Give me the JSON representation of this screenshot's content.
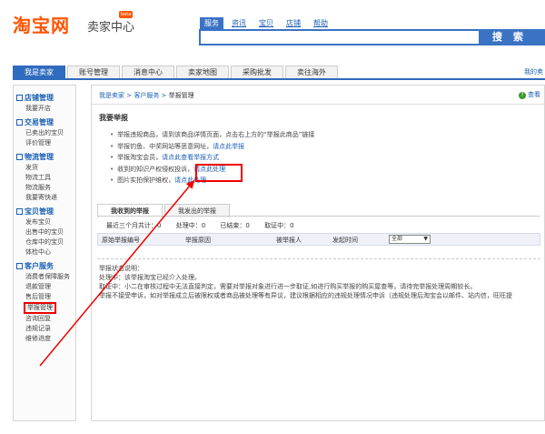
{
  "header": {
    "logo": "淘宝网",
    "logo_sub": "卖家中心",
    "beta": "beta",
    "search_tabs": [
      "服务",
      "资讯",
      "宝贝",
      "店铺",
      "帮助"
    ],
    "search_button": "搜 索"
  },
  "nav": {
    "items": [
      "我是卖家",
      "账号管理",
      "消息中心",
      "卖家地图",
      "采购批发",
      "卖往海外"
    ],
    "right": "我的卖"
  },
  "sidebar": {
    "groups": [
      {
        "title": "店铺管理",
        "items": [
          "我要开店"
        ]
      },
      {
        "title": "交易管理",
        "items": [
          "已卖出的宝贝",
          "评价管理"
        ]
      },
      {
        "title": "物流管理",
        "items": [
          "发货",
          "物流工具",
          "物流服务",
          "我要寄快递"
        ]
      },
      {
        "title": "宝贝管理",
        "items": [
          "发布宝贝",
          "出售中的宝贝",
          "仓库中的宝贝",
          "体检中心"
        ]
      },
      {
        "title": "客户服务",
        "items": [
          "消费者保障服务",
          "退款管理",
          "售后管理",
          "举报管理",
          "咨询回复",
          "违规记录",
          "维修进度"
        ]
      }
    ]
  },
  "main": {
    "crumbs": [
      "我是卖家",
      "客户服务",
      "举报管理"
    ],
    "help": "查看",
    "section_title": "我要举报",
    "bullets": [
      {
        "text": "举报违规商品，请到该商品详情页面，点击右上方的“举报此商品”链接",
        "link": ""
      },
      {
        "text": "举报钓鱼、中奖网站等恶意网址，",
        "link": "请点此举报"
      },
      {
        "text": "举报淘宝会员，",
        "link": "请点此查看举报方式"
      },
      {
        "text": "收到的知识产权侵权投诉，",
        "link": "请点此处理"
      },
      {
        "text": "图片实拍保护维权，",
        "link": "请点此处理"
      }
    ],
    "tabs": [
      "我收到的举报",
      "我发出的举报"
    ],
    "stats": [
      "最近三个月共计：0",
      "处理中：0",
      "已结束：0",
      "取证中：0"
    ],
    "columns": [
      "原始举报编号",
      "举报原因",
      "被举报人",
      "发起时间"
    ],
    "filter_value": "全部",
    "notes": [
      "举报状态说明：",
      "处理中：该举报淘宝已经介入处理。",
      "取证中：小二在审核过程中无法直接判定，需要对举报对象进行进一步取证,如进行购买举报的购买屋查等，请待完举报处理周期较长。",
      "举报不接受申诉，如对举报成立后被限权或者商品被处理等有异议，建议根据相应的违规处理情况申诉（违规处理后淘宝会以邮件、站内信，旺旺提"
    ]
  }
}
